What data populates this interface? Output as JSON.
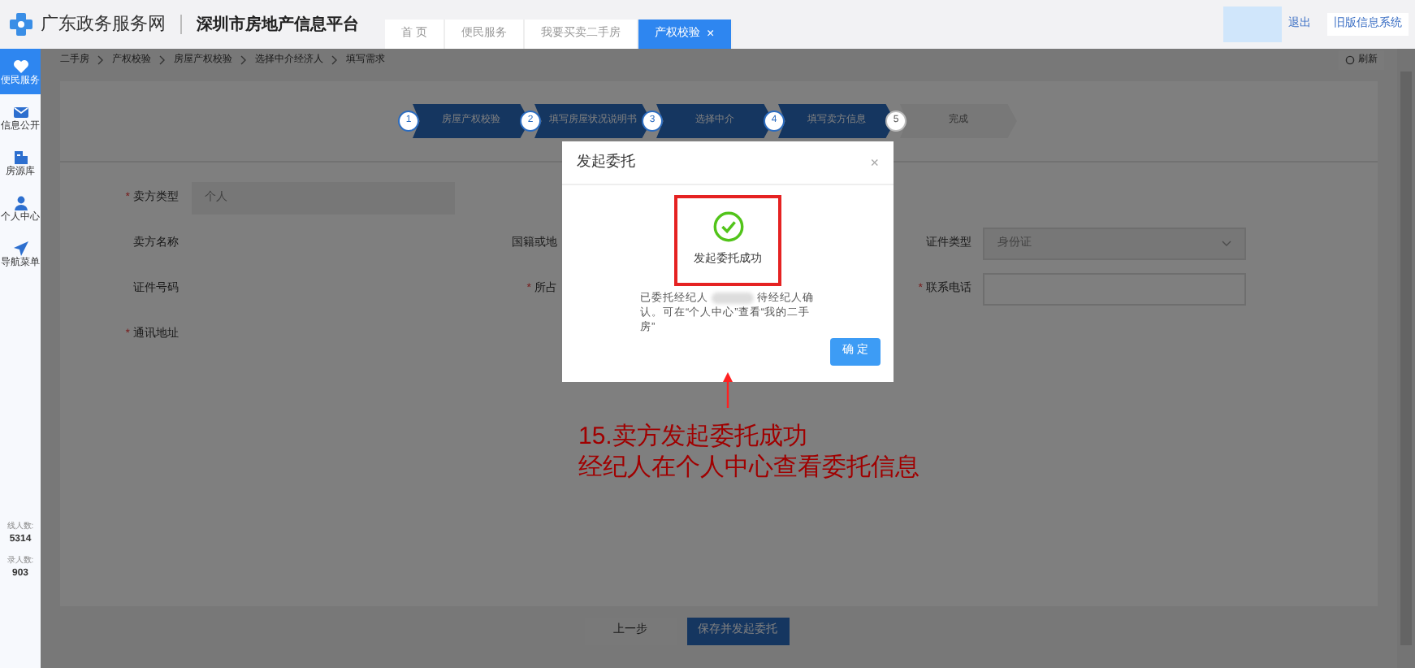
{
  "header": {
    "portal_name": "广东政务服务网",
    "platform_name": "深圳市房地产信息平台",
    "tabs": [
      {
        "label": "首 页",
        "selected": false,
        "closable": false
      },
      {
        "label": "便民服务",
        "selected": false,
        "closable": false
      },
      {
        "label": "我要买卖二手房",
        "selected": false,
        "closable": false
      },
      {
        "label": "产权校验",
        "selected": true,
        "closable": true
      }
    ],
    "close_glyph": "×",
    "logout": "退出",
    "old_system": "旧版信息系统"
  },
  "sidebar": {
    "items": [
      {
        "label": "便民服务",
        "selected": true
      },
      {
        "label": "信息公开",
        "selected": false
      },
      {
        "label": "房源库",
        "selected": false
      },
      {
        "label": "个人中心",
        "selected": false
      },
      {
        "label": "导航菜单",
        "selected": false
      }
    ],
    "stats": [
      {
        "label": "线人数:",
        "value": "5314"
      },
      {
        "label": "录人数:",
        "value": "903"
      }
    ]
  },
  "breadcrumb": [
    "二手房",
    "产权校验",
    "房屋产权校验",
    "选择中介经济人",
    "填写需求"
  ],
  "refresh": "刷新",
  "steps": [
    {
      "number": "1",
      "label": "房屋产权校验",
      "active": true
    },
    {
      "number": "2",
      "label": "填写房屋状况说明书",
      "active": true
    },
    {
      "number": "3",
      "label": "选择中介",
      "active": true
    },
    {
      "number": "4",
      "label": "填写卖方信息",
      "active": true
    },
    {
      "number": "5",
      "label": "完成",
      "active": false
    }
  ],
  "form": {
    "required_mark": "*",
    "rows": [
      [
        {
          "label": "卖方类型",
          "required": true,
          "value": "个人"
        }
      ],
      [
        {
          "label": "卖方名称",
          "required": false
        },
        {
          "label": "国籍或地",
          "required": false
        },
        {
          "label": "证件类型",
          "required": false,
          "value": "身份证",
          "kind": "select"
        }
      ],
      [
        {
          "label": "证件号码",
          "required": false
        },
        {
          "label": "所占",
          "required": true
        },
        {
          "label": "联系电话",
          "required": true,
          "kind": "input"
        }
      ],
      [
        {
          "label": "通讯地址",
          "required": true
        }
      ]
    ]
  },
  "buttons": {
    "prev": "上一步",
    "submit": "保存并发起委托"
  },
  "dialog": {
    "title": "发起委托",
    "close": "×",
    "success_text": "发起委托成功",
    "message_before": "已委托经纪人",
    "message_after": "待经纪人确认。可在“个人中心”查看“我的二手房”",
    "confirm": "确 定"
  },
  "annotation": {
    "lines": [
      "15.卖方发起委托成功",
      "经纪人在个人中心查看委托信息"
    ]
  }
}
